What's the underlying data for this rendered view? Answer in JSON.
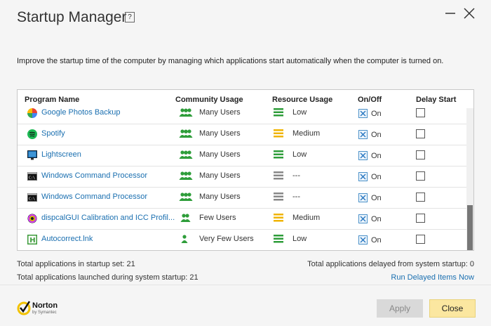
{
  "window": {
    "title": "Startup Manager",
    "help_label": "?"
  },
  "description": "Improve the startup time of the computer by managing which applications start automatically when the computer is turned on.",
  "table": {
    "headers": [
      "Program Name",
      "Community Usage",
      "Resource Usage",
      "On/Off",
      "Delay Start"
    ],
    "rows": [
      {
        "name": "Google Photos Backup",
        "community": "Many Users",
        "community_level": "many",
        "resource": "Low",
        "resource_level": "low",
        "on": "On"
      },
      {
        "name": "Spotify",
        "community": "Many Users",
        "community_level": "many",
        "resource": "Medium",
        "resource_level": "medium",
        "on": "On"
      },
      {
        "name": "Lightscreen",
        "community": "Many Users",
        "community_level": "many",
        "resource": "Low",
        "resource_level": "low",
        "on": "On"
      },
      {
        "name": "Windows Command Processor",
        "community": "Many Users",
        "community_level": "many",
        "resource": "---",
        "resource_level": "unknown",
        "on": "On"
      },
      {
        "name": "Windows Command Processor",
        "community": "Many Users",
        "community_level": "many",
        "resource": "---",
        "resource_level": "unknown",
        "on": "On"
      },
      {
        "name": "dispcalGUI Calibration and ICC Profil...",
        "community": "Few Users",
        "community_level": "few",
        "resource": "Medium",
        "resource_level": "medium",
        "on": "On"
      },
      {
        "name": "Autocorrect.lnk",
        "community": "Very Few Users",
        "community_level": "veryfew",
        "resource": "Low",
        "resource_level": "low",
        "on": "On"
      }
    ]
  },
  "summary": {
    "startup_set": "Total applications in startup set: 21",
    "launched": "Total applications launched during system startup: 21",
    "delayed": "Total applications delayed from system startup: 0",
    "run_delayed": "Run Delayed Items Now"
  },
  "footer": {
    "brand": "Norton",
    "brand_sub": "by Symantec",
    "apply": "Apply",
    "close": "Close"
  },
  "colors": {
    "link": "#1a6fb0",
    "green": "#2e9d3a",
    "amber": "#f0b400",
    "gray": "#888888",
    "close_btn": "#fbe7a0"
  },
  "icons": [
    "help-icon",
    "minimize-icon",
    "close-icon",
    "google-photos-icon",
    "spotify-icon",
    "lightscreen-icon",
    "cmd-icon",
    "dispcal-icon",
    "autocorrect-icon",
    "users-icon",
    "resource-bars-icon",
    "norton-check-icon"
  ]
}
